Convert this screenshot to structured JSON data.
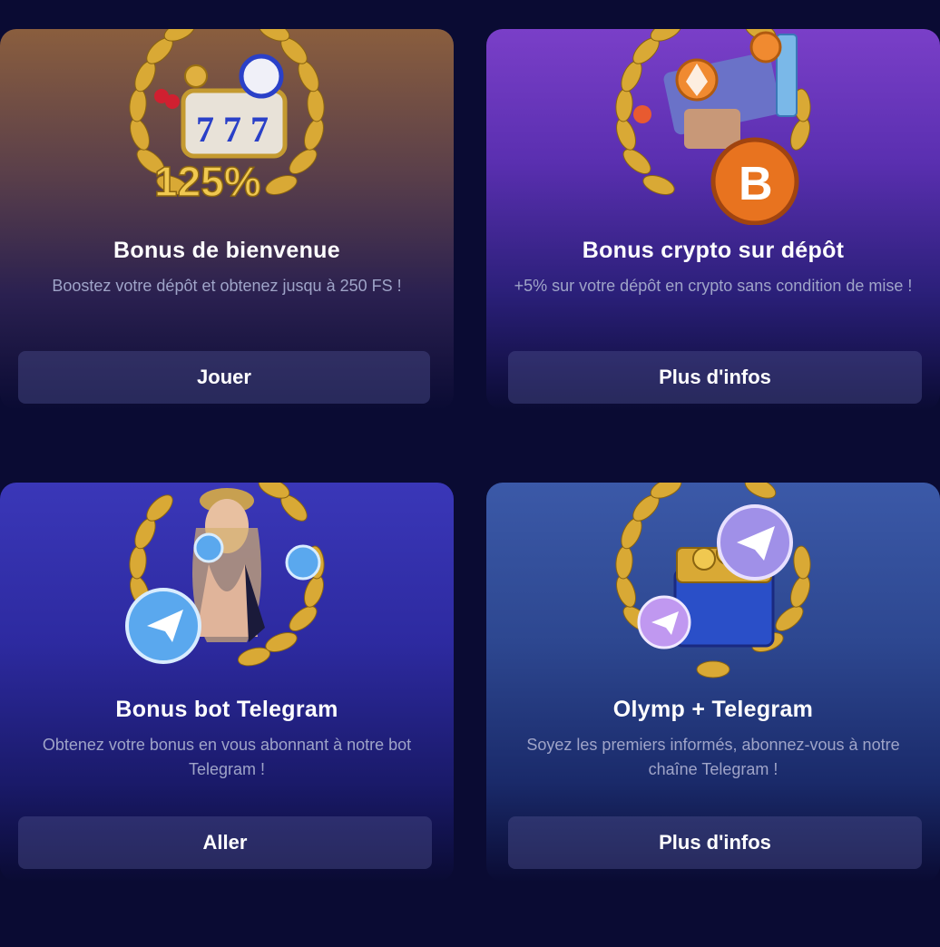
{
  "cards": [
    {
      "title": "Bonus de bienvenue",
      "description": "Boostez votre dépôt et obtenez jusqu à 250 FS !",
      "button": "Jouer",
      "badge": "125%",
      "icon": "slot-machine-laurel-icon"
    },
    {
      "title": "Bonus crypto sur dépôt",
      "description": "+5% sur votre dépôt en crypto sans condition de mise !",
      "button": "Plus d'infos",
      "icon": "crypto-coins-laurel-icon"
    },
    {
      "title": "Bonus bot Telegram",
      "description": "Obtenez votre bonus en vous abonnant à notre bot Telegram !",
      "button": "Aller",
      "icon": "telegram-bot-laurel-icon"
    },
    {
      "title": "Olymp + Telegram",
      "description": "Soyez les premiers informés, abonnez-vous à notre chaîne Telegram !",
      "button": "Plus d'infos",
      "icon": "telegram-chest-laurel-icon"
    }
  ],
  "colors": {
    "page_bg": "#0a0b33",
    "laurel_gold": "#d9a935",
    "title_text": "#ffffff",
    "desc_text": "#9fa4c8",
    "button_bg": "#2f3170",
    "telegram_blue": "#5aa8ee",
    "bitcoin_orange": "#e8731f"
  }
}
